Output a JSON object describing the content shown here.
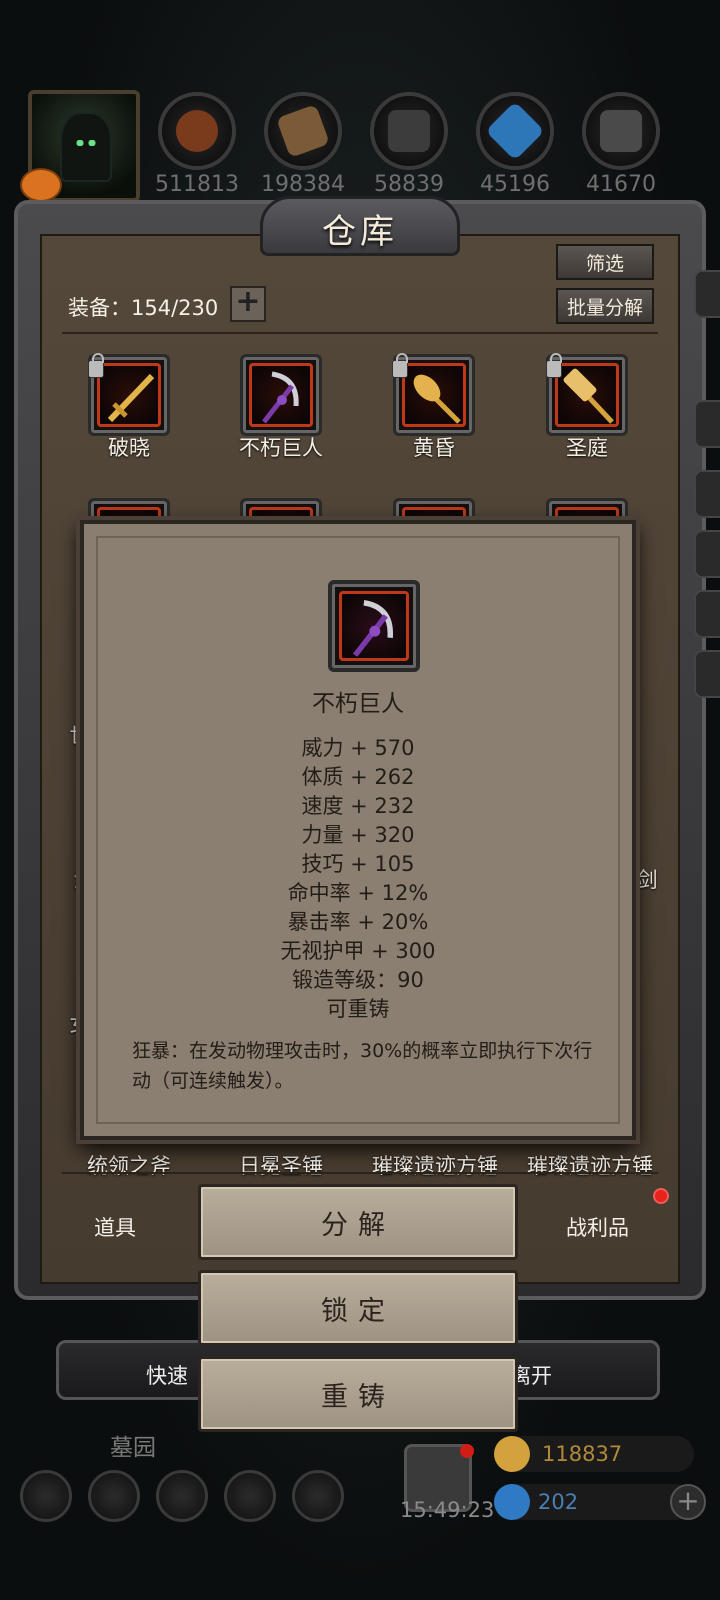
{
  "resources": {
    "counts": [
      "511813",
      "198384",
      "58839",
      "45196",
      "41670"
    ],
    "icons": [
      "meat-icon",
      "wood-icon",
      "stone-icon",
      "crystal-icon",
      "iron-icon"
    ]
  },
  "warehouse": {
    "title": "仓库",
    "filter_label": "筛选",
    "batch_label": "批量分解",
    "equip_label": "装备：154/230",
    "plus": "+"
  },
  "items_row1": [
    {
      "name": "破晓",
      "icon": "sword-icon",
      "locked": true
    },
    {
      "name": "不朽巨人",
      "icon": "scythe-icon",
      "locked": false
    },
    {
      "name": "黄昏",
      "icon": "axe-icon",
      "locked": true
    },
    {
      "name": "圣庭",
      "icon": "hammer-icon",
      "locked": true
    }
  ],
  "partial_labels": {
    "left_1": "世",
    "left_2": "汽",
    "left_3": "女",
    "right_1": "剑"
  },
  "items_bottom_partial": [
    "统领之斧",
    "日冕圣锤",
    "璀璨遗迹方锤",
    "璀璨遗迹方锤"
  ],
  "tabs": {
    "items": "道具",
    "loot": "战利品"
  },
  "actions": {
    "decompose": "分解",
    "lock": "锁定",
    "reforge": "重铸"
  },
  "under_bar": {
    "left": "快速",
    "right": "离开"
  },
  "footer": {
    "location": "墓园",
    "time": "15:49:23",
    "gold": "118837",
    "gems": "202"
  },
  "popup": {
    "name": "不朽巨人",
    "stats": [
      "威力 + 570",
      "体质 + 262",
      "速度 + 232",
      "力量 + 320",
      "技巧 + 105",
      "命中率 + 12%",
      "暴击率 + 20%",
      "无视护甲 + 300",
      "锻造等级：90",
      "可重铸"
    ],
    "description": "狂暴：在发动物理攻击时，30%的概率立即执行下次行动（可连续触发）。"
  },
  "colors": {
    "panel": "#4f4337",
    "popup": "#8b7f71",
    "button": "#ab9f8e",
    "accent_red": "#c0381a"
  }
}
